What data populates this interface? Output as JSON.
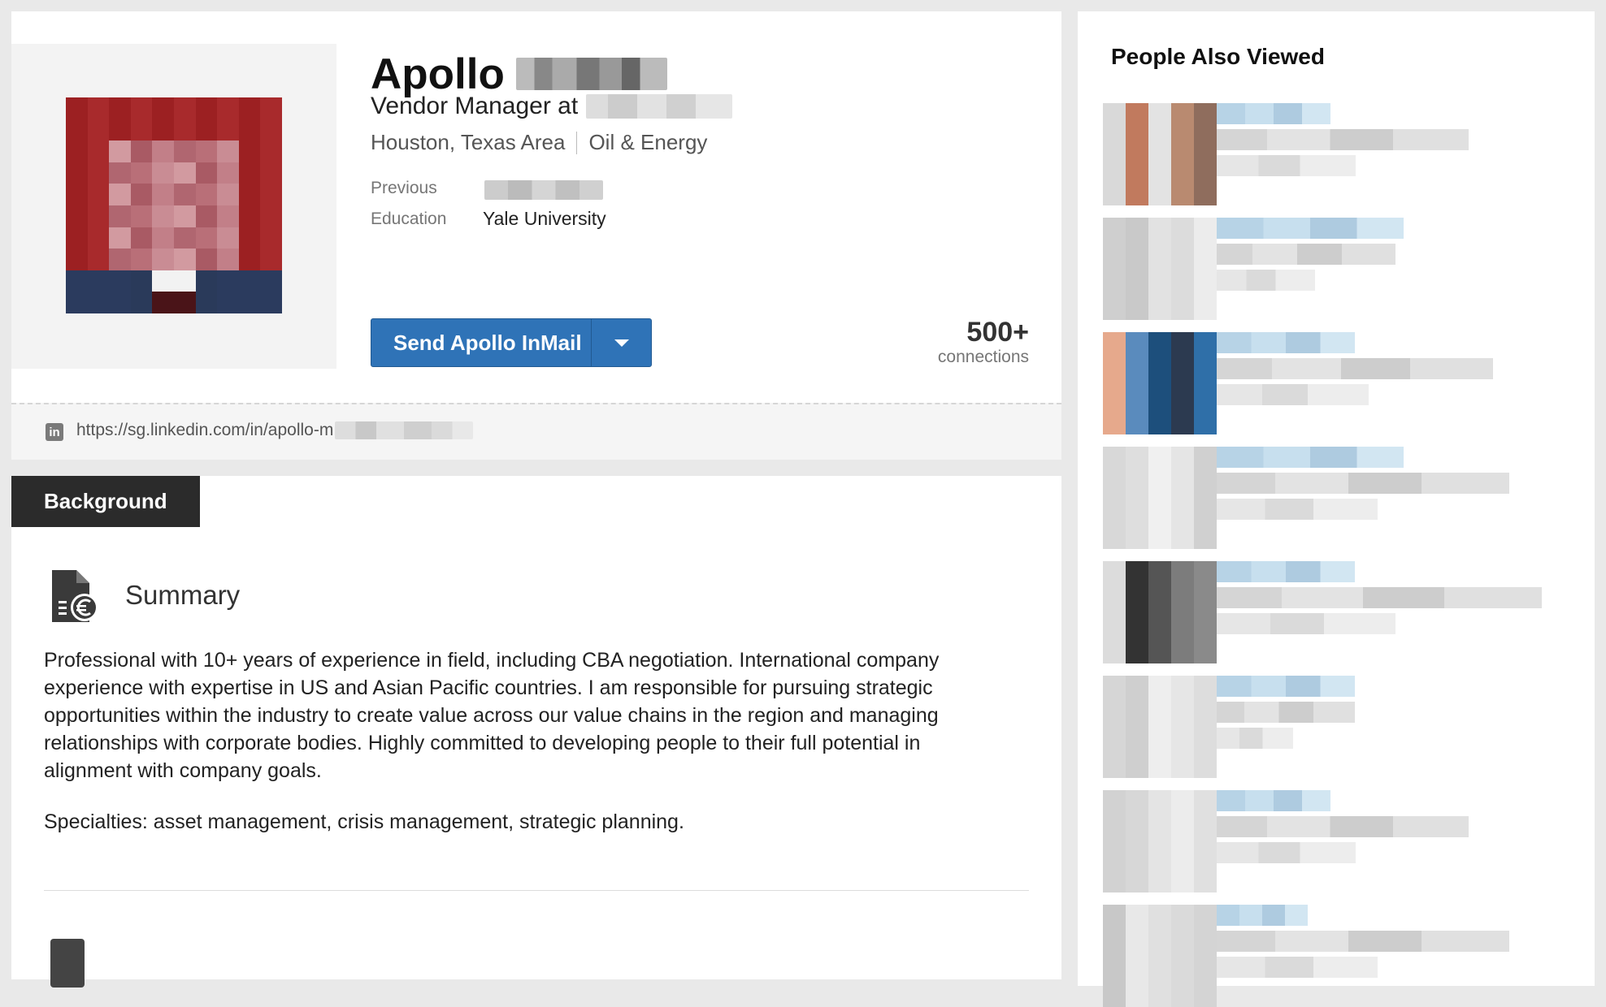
{
  "profile": {
    "first_name": "Apollo",
    "headline_prefix": "Vendor Manager at",
    "location": "Houston, Texas Area",
    "industry": "Oil & Energy",
    "previous_label": "Previous",
    "education_label": "Education",
    "education_value": "Yale University",
    "inmail_button_label": "Send Apollo InMail",
    "connections_count": "500+",
    "connections_label": "connections",
    "public_url": "https://sg.linkedin.com/in/apollo-m",
    "linkedin_icon_text": "in"
  },
  "background": {
    "tab_label": "Background",
    "summary_title": "Summary",
    "summary_text": "Professional with 10+ years of experience in field, including CBA negotiation. International company experience with expertise in US and Asian Pacific countries. I am responsible for pursuing strategic opportunities within the industry to create value across our value chains in the region and managing relationships with corporate bodies. Highly committed to developing people to their full potential in alignment with company goals.",
    "specialties": "Specialties: asset management, crisis management, strategic planning."
  },
  "sidebar": {
    "title": "People Also Viewed"
  },
  "colors": {
    "inmail_button": "#2f73b7",
    "tab_background": "#2b2b2b",
    "photo_background": "#a52426"
  }
}
